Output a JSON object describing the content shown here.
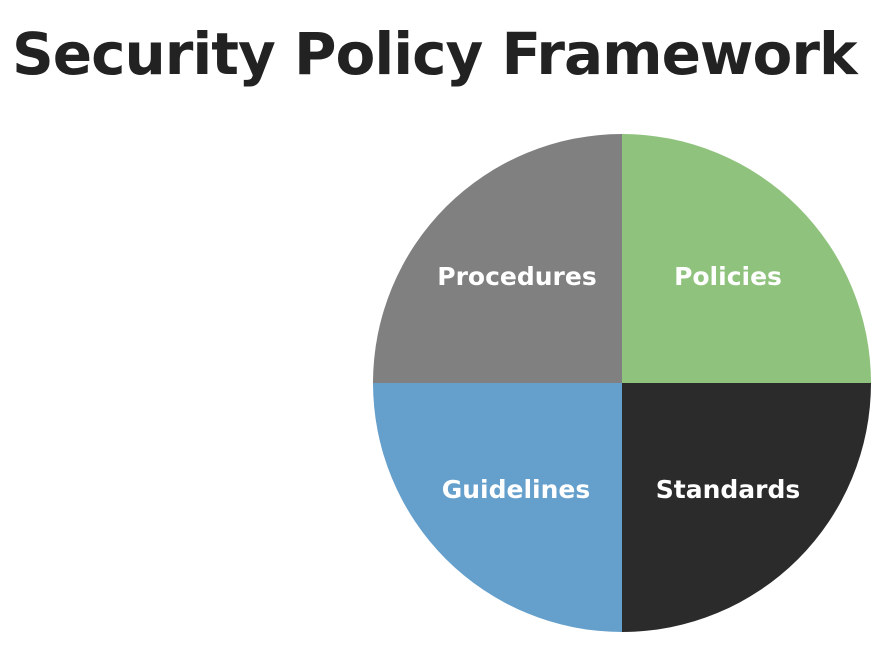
{
  "title": "Security Policy Framework",
  "diagram": {
    "quadrants": [
      {
        "key": "procedures",
        "label": "Procedures",
        "color": "#808080"
      },
      {
        "key": "policies",
        "label": "Policies",
        "color": "#8fc37d"
      },
      {
        "key": "guidelines",
        "label": "Guidelines",
        "color": "#659fcb"
      },
      {
        "key": "standards",
        "label": "Standards",
        "color": "#2b2b2b"
      }
    ],
    "label_colors": {
      "procedures": "#ffffff",
      "policies": "#ffffff",
      "guidelines": "#ffffff",
      "standards": "#ffffff"
    }
  }
}
